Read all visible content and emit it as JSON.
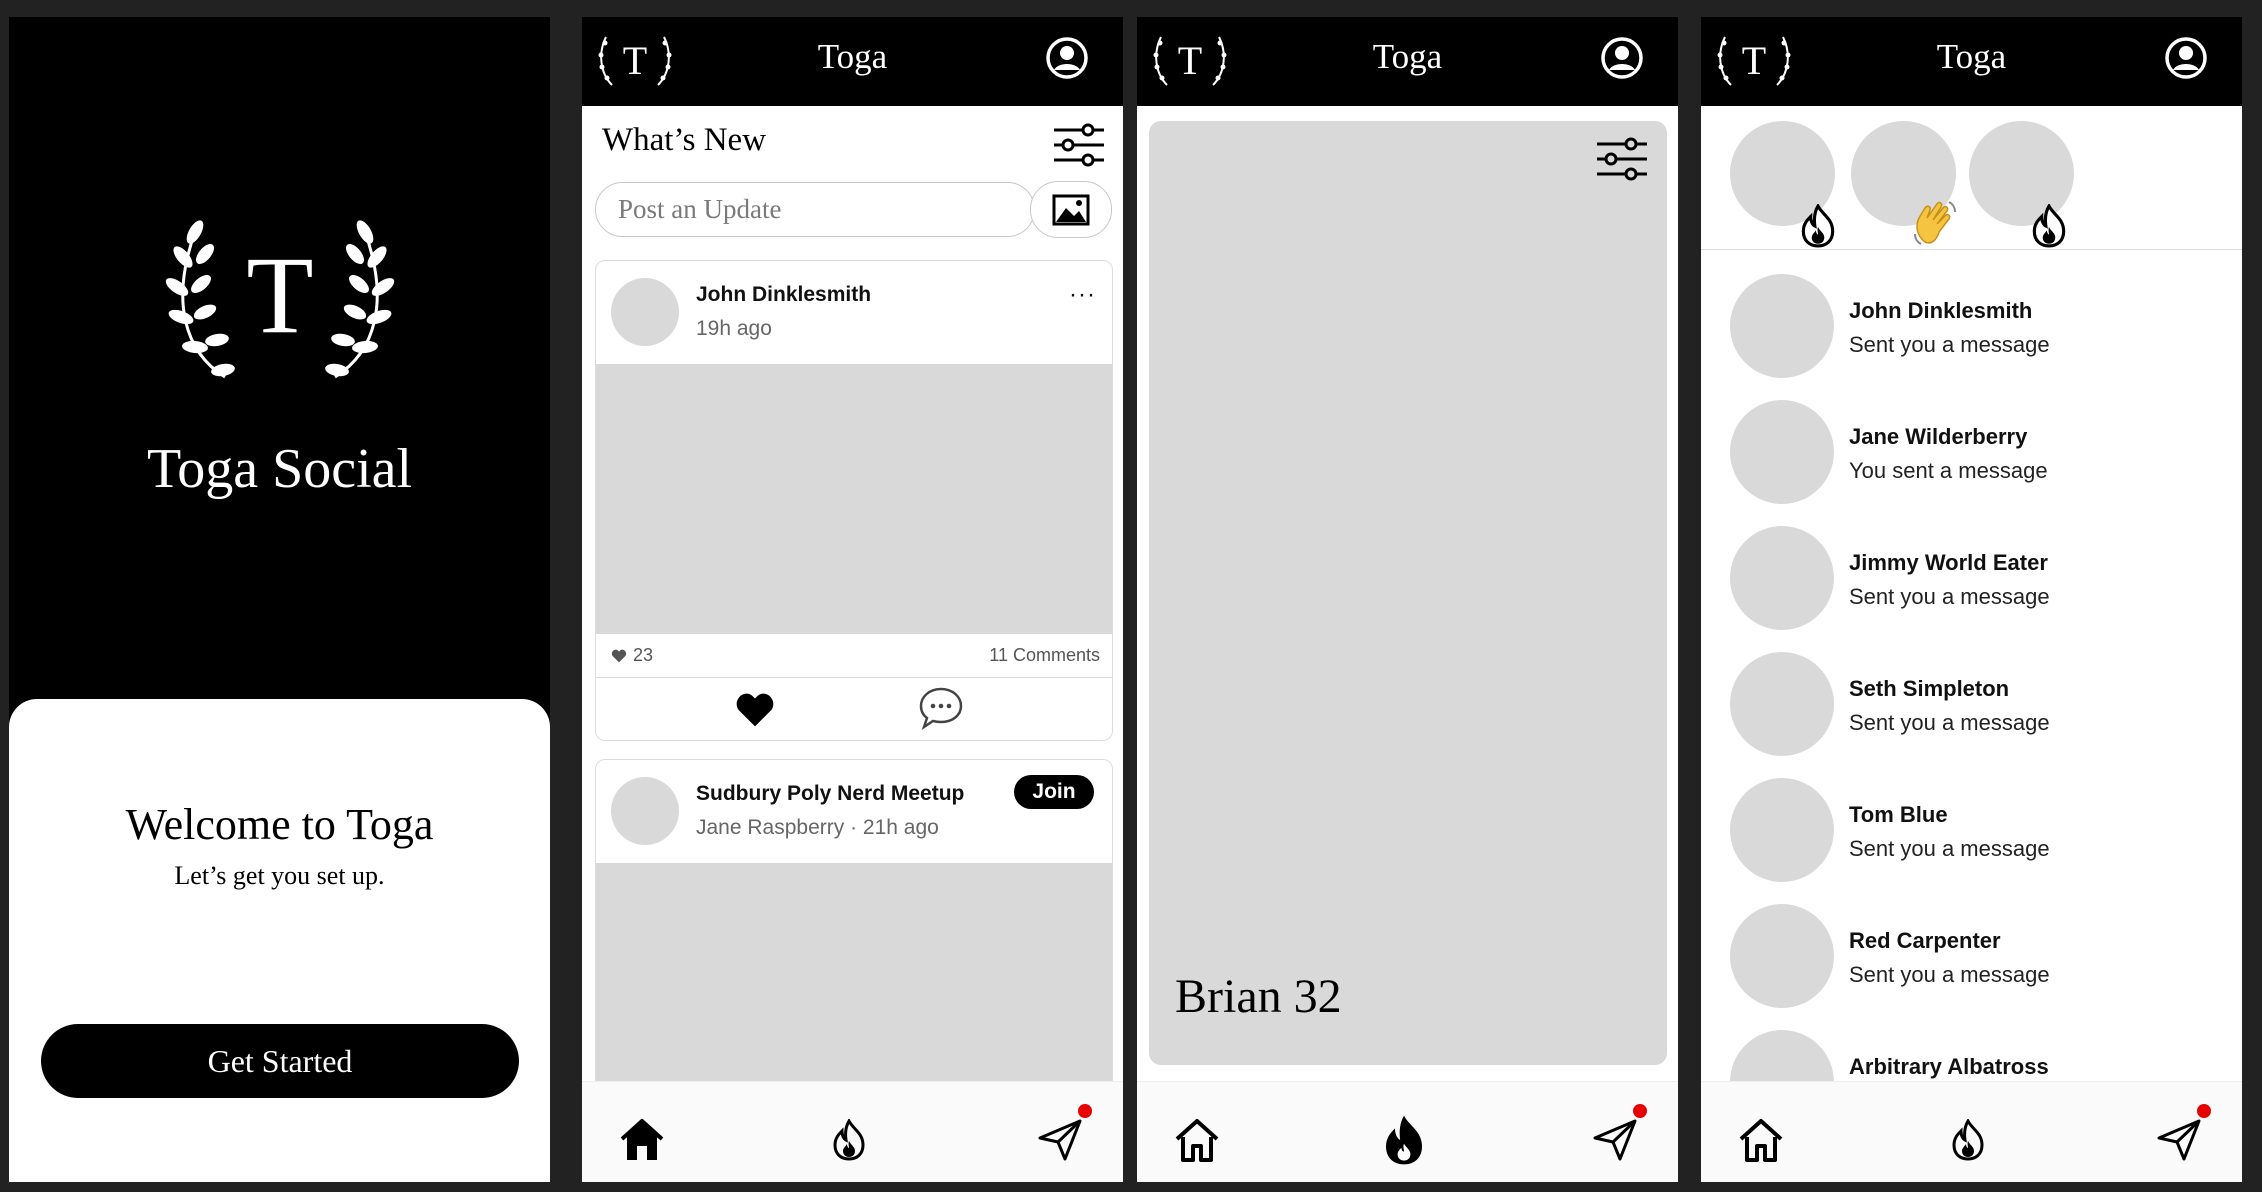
{
  "screens": {
    "welcome": {
      "app_name": "Toga Social",
      "logo_letter": "T",
      "welcome_title": "Welcome to Toga",
      "welcome_subtitle": "Let’s get you set up.",
      "get_started_label": "Get Started"
    },
    "feed": {
      "header_title": "Toga",
      "logo_letter": "T",
      "section_title": "What’s New",
      "post_placeholder": "Post an Update",
      "posts": [
        {
          "author": "John Dinklesmith",
          "time": "19h ago",
          "more": "···",
          "likes": "23",
          "comments": "11 Comments"
        },
        {
          "group": "Sudbury Poly Nerd Meetup",
          "meta": "Jane Raspberry · 21h ago",
          "join_label": "Join"
        }
      ]
    },
    "discover": {
      "header_title": "Toga",
      "logo_letter": "T",
      "profile_name": "Brian 32"
    },
    "messages": {
      "header_title": "Toga",
      "logo_letter": "T",
      "stories": [
        {
          "badge": "fire-icon"
        },
        {
          "badge": "waving-hand-icon"
        },
        {
          "badge": "fire-icon"
        }
      ],
      "chats": [
        {
          "name": "John Dinklesmith",
          "message": "Sent you a message"
        },
        {
          "name": "Jane Wilderberry",
          "message": "You sent a message"
        },
        {
          "name": "Jimmy World Eater",
          "message": "Sent you a message"
        },
        {
          "name": "Seth Simpleton",
          "message": "Sent you a message"
        },
        {
          "name": "Tom Blue",
          "message": "Sent you a message"
        },
        {
          "name": "Red Carpenter",
          "message": "Sent you a message"
        },
        {
          "name": "Arbitrary Albatross",
          "message": ""
        }
      ]
    }
  },
  "colors": {
    "background": "#222222",
    "header": "#000000",
    "placeholder_gray": "#d9d9d9",
    "notification_dot": "#e60000"
  }
}
